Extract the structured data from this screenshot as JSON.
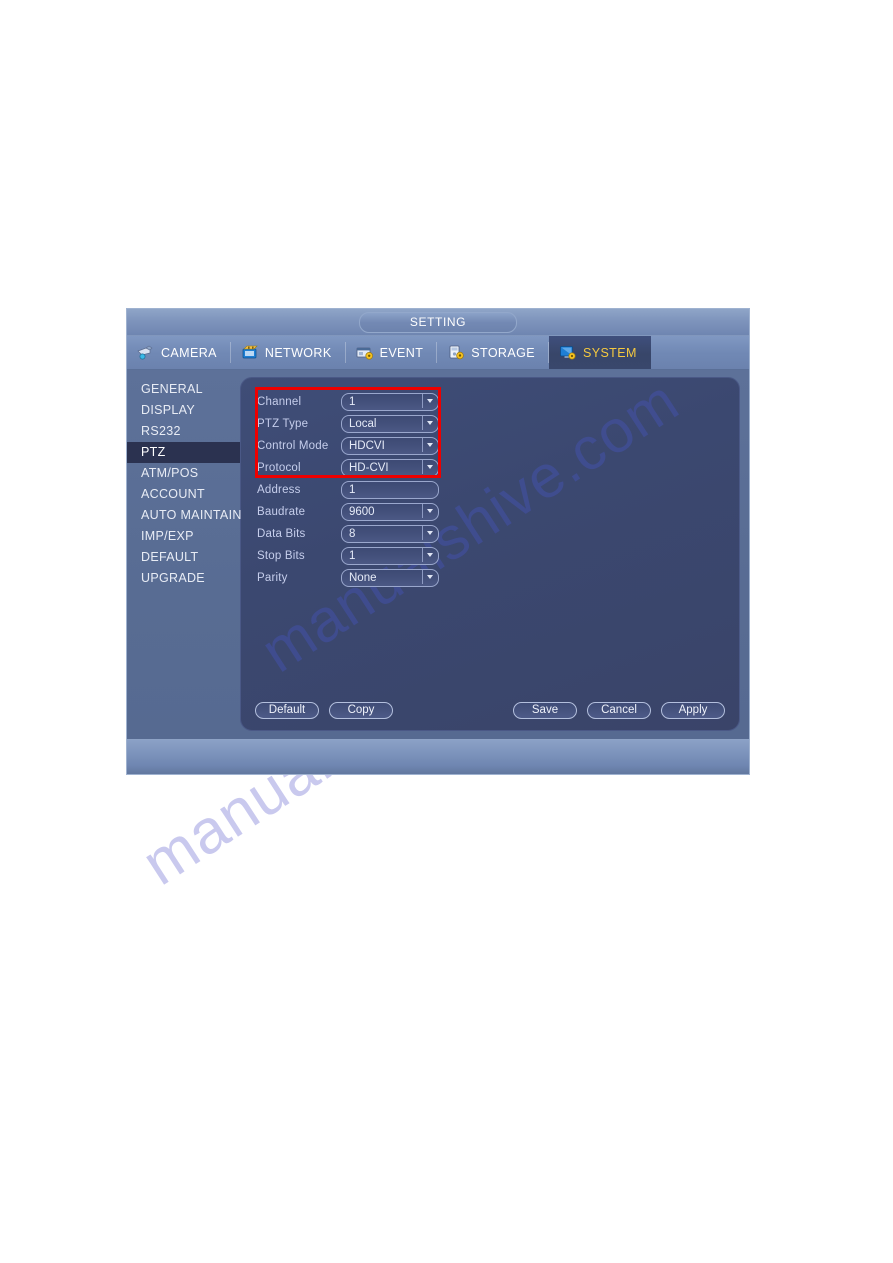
{
  "window": {
    "title": "SETTING"
  },
  "tabs": [
    {
      "label": "CAMERA",
      "icon": "camera-icon",
      "active": false
    },
    {
      "label": "NETWORK",
      "icon": "network-icon",
      "active": false
    },
    {
      "label": "EVENT",
      "icon": "event-icon",
      "active": false
    },
    {
      "label": "STORAGE",
      "icon": "storage-icon",
      "active": false
    },
    {
      "label": "SYSTEM",
      "icon": "system-icon",
      "active": true
    }
  ],
  "sidebar": {
    "items": [
      {
        "label": "GENERAL",
        "selected": false
      },
      {
        "label": "DISPLAY",
        "selected": false
      },
      {
        "label": "RS232",
        "selected": false
      },
      {
        "label": "PTZ",
        "selected": true
      },
      {
        "label": "ATM/POS",
        "selected": false
      },
      {
        "label": "ACCOUNT",
        "selected": false
      },
      {
        "label": "AUTO MAINTAIN",
        "selected": false
      },
      {
        "label": "IMP/EXP",
        "selected": false
      },
      {
        "label": "DEFAULT",
        "selected": false
      },
      {
        "label": "UPGRADE",
        "selected": false
      }
    ]
  },
  "form": {
    "fields": [
      {
        "label": "Channel",
        "value": "1",
        "type": "dropdown",
        "highlighted": true
      },
      {
        "label": "PTZ Type",
        "value": "Local",
        "type": "dropdown",
        "highlighted": true
      },
      {
        "label": "Control Mode",
        "value": "HDCVI",
        "type": "dropdown",
        "highlighted": true
      },
      {
        "label": "Protocol",
        "value": "HD-CVI",
        "type": "dropdown",
        "highlighted": true
      },
      {
        "label": "Address",
        "value": "1",
        "type": "text",
        "highlighted": false
      },
      {
        "label": "Baudrate",
        "value": "9600",
        "type": "dropdown",
        "highlighted": false
      },
      {
        "label": "Data Bits",
        "value": "8",
        "type": "dropdown",
        "highlighted": false
      },
      {
        "label": "Stop Bits",
        "value": "1",
        "type": "dropdown",
        "highlighted": false
      },
      {
        "label": "Parity",
        "value": "None",
        "type": "dropdown",
        "highlighted": false
      }
    ]
  },
  "buttons": {
    "left": [
      {
        "label": "Default"
      },
      {
        "label": "Copy"
      }
    ],
    "right": [
      {
        "label": "Save"
      },
      {
        "label": "Cancel"
      },
      {
        "label": "Apply"
      }
    ]
  },
  "watermark": {
    "text": "manualshive.com"
  },
  "colors": {
    "accent_active_tab_text": "#f5c940",
    "highlight_box": "#ee0000",
    "dialog_bg": "#5d7199",
    "content_bg": "#3b4870",
    "sidebar_selected": "#2b3250"
  }
}
